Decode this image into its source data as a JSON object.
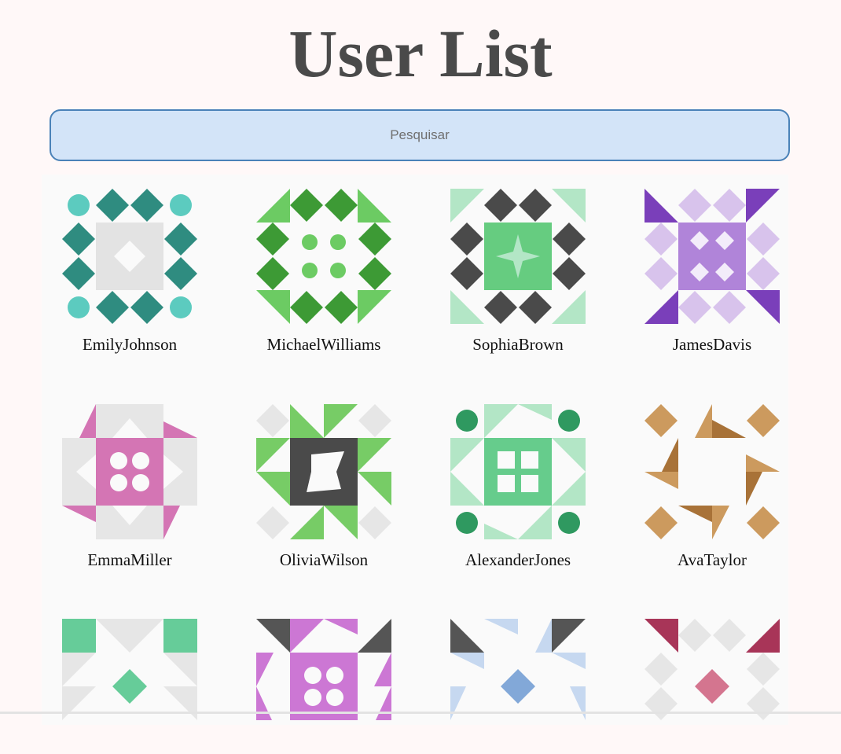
{
  "page": {
    "title": "User List"
  },
  "search": {
    "placeholder": "Pesquisar"
  },
  "users": [
    {
      "name": "EmilyJohnson",
      "icon": "quilt-teal-avatar"
    },
    {
      "name": "MichaelWilliams",
      "icon": "quilt-green-avatar"
    },
    {
      "name": "SophiaBrown",
      "icon": "quilt-mint-avatar"
    },
    {
      "name": "JamesDavis",
      "icon": "quilt-purple-avatar"
    },
    {
      "name": "EmmaMiller",
      "icon": "quilt-pink-avatar"
    },
    {
      "name": "OliviaWilson",
      "icon": "quilt-lime-avatar"
    },
    {
      "name": "AlexanderJones",
      "icon": "quilt-emerald-avatar"
    },
    {
      "name": "AvaTaylor",
      "icon": "quilt-tan-avatar"
    },
    {
      "name": "",
      "icon": "quilt-seafoam-avatar"
    },
    {
      "name": "",
      "icon": "quilt-orchid-avatar"
    },
    {
      "name": "",
      "icon": "quilt-blue-avatar"
    },
    {
      "name": "",
      "icon": "quilt-crimson-avatar"
    }
  ],
  "colors": {
    "title": "#4a4a4a",
    "search_bg": "#d3e4f8",
    "search_border": "#4a82b8"
  }
}
